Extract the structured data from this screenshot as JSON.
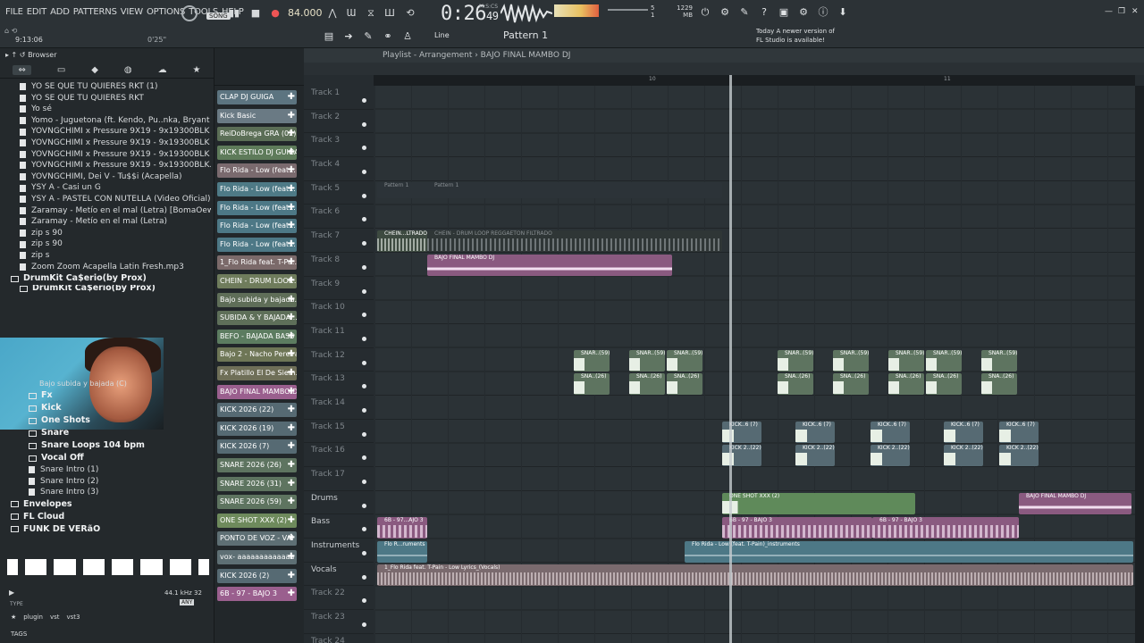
{
  "menu": [
    "FILE",
    "EDIT",
    "ADD",
    "PATTERNS",
    "VIEW",
    "OPTIONS",
    "TOOLS",
    "HELP"
  ],
  "transport": {
    "song_label": "SONG",
    "tempo": "84.000",
    "time": "0:26",
    "time_frac": "49",
    "msc": "M:S:CS",
    "memory": "1229 MB",
    "cpu_top": "5",
    "cpu_bottom": "1"
  },
  "hint": {
    "icon_text": "⌂ ⟲",
    "time": "9:13:06",
    "zoom": "0'25\""
  },
  "toolbar2": {
    "line_label": "Line",
    "pattern_label": "Pattern 1"
  },
  "news": {
    "line1": "Today  A newer version of",
    "line2": "FL Studio is available!"
  },
  "browser": {
    "title": "Browser",
    "files": [
      "YO SE QUE TU QUIERES RKT (1)",
      "YO SE QUE TU QUIERES RKT",
      "Yo sé",
      "Yomo - Juguetona (ft. Kendo, Pu..nka, Bryant Myers, Young Izak)",
      "YOVNGCHIMI x Pressure 9X19 - 9x19300BLK [bass]",
      "YOVNGCHIMI x Pressure 9X19 - 9x19300BLK [vocals]",
      "YOVNGCHIMI x Pressure 9X19 - 9x19300BLK",
      "YOVNGCHIMI x Pressure 9X19 - 9x19300BLK.stem",
      "YOVNGCHIMI, Dei V - Tu$$i (Acapella)",
      "YSY A - Casi un G",
      "YSY A - PASTEL CON NUTELLA (Video Oficial)",
      "Zaramay - Metío en el mal (Letra) [BomaOewl4T0]",
      "Zaramay - Metío en el mal (Letra)",
      "zip s 90",
      "zip s 90",
      "zip s",
      "Zoom Zoom Acapella Latin Fresh.mp3"
    ],
    "folders1": [
      "DrumKit Ca$erio(by Prox)",
      "DrumKit Ca$erio(by Prox)"
    ],
    "file_after_cam": "Bajo subida y bajada (C)",
    "subfolders": [
      "Fx",
      "Kick",
      "One Shots",
      "Snare",
      "Snare Loops 104 bpm",
      "Vocal Off"
    ],
    "snare_intros": [
      "Snare Intro (1)",
      "Snare Intro (2)",
      "Snare Intro (3)"
    ],
    "bottom_folders": [
      "Envelopes",
      "FL Cloud",
      "FUNK DE VERãO"
    ],
    "sample_rate": "44.1 kHz 32",
    "any": "ANY",
    "type_label": "TYPE",
    "filter_tags": [
      "plugin",
      "vst",
      "vst3"
    ],
    "tags_label": "TAGS"
  },
  "channels": [
    {
      "name": "CLAP DJ GUIGA",
      "color": "#5c7480"
    },
    {
      "name": "Kick Basic",
      "color": "#6a7a84"
    },
    {
      "name": "ReiDoBrega GRA (02)",
      "color": "#5b6e56"
    },
    {
      "name": "KICK ESTILO DJ GUIGA",
      "color": "#5e7b5a"
    },
    {
      "name": "Flo Rida - Low (feat...",
      "color": "#7a6a6e"
    },
    {
      "name": "Flo Rida - Low (feat...",
      "color": "#4e7a86"
    },
    {
      "name": "Flo Rida - Low (feat...",
      "color": "#4d7886"
    },
    {
      "name": "Flo Rida - Low (feat...",
      "color": "#4d7886"
    },
    {
      "name": "Flo Rida - Low (feat...",
      "color": "#4d7886"
    },
    {
      "name": "1_Flo Rida feat. T-Pa...",
      "color": "#7b6a6a"
    },
    {
      "name": "CHEIN - DRUM LOOP...",
      "color": "#6f7c5c"
    },
    {
      "name": "Bajo subida y bajada...",
      "color": "#5f6e58"
    },
    {
      "name": "SUBIDA & Y BAJADA...",
      "color": "#5e6f59"
    },
    {
      "name": "BEFO - BAJADA BASS",
      "color": "#5c7c60"
    },
    {
      "name": "Bajo 2 - Nacho Pereira",
      "color": "#6e7656"
    },
    {
      "name": "Fx Platillo El De Siem...",
      "color": "#6f6f58"
    },
    {
      "name": "BAJO FINAL MAMBO DJ",
      "color": "#9a5f8e"
    },
    {
      "name": "KICK 2026 (22)",
      "color": "#566a73"
    },
    {
      "name": "KICK 2026 (19)",
      "color": "#566a73"
    },
    {
      "name": "KICK 2026 (7)",
      "color": "#566a73"
    },
    {
      "name": "SNARE 2026 (26)",
      "color": "#5e7460"
    },
    {
      "name": "SNARE 2026 (31)",
      "color": "#5e7460"
    },
    {
      "name": "SNARE 2026 (59)",
      "color": "#5e7460"
    },
    {
      "name": "ONE SHOT XXX (2)",
      "color": "#6e8a5c"
    },
    {
      "name": "PONTO DE VOZ - VAI",
      "color": "#5e6f74"
    },
    {
      "name": "vox- aaaaaaaaaaaaa",
      "color": "#5e6f74"
    },
    {
      "name": "KICK 2026 (2)",
      "color": "#566a73"
    },
    {
      "name": "6B - 97 - BAJO 3",
      "color": "#9a5f8e"
    }
  ],
  "playlist": {
    "title": "Playlist - Arrangement › BAJO FINAL MAMBO DJ",
    "ruler_marks": [
      "10",
      "11"
    ],
    "tracks": [
      "Track 1",
      "Track 2",
      "Track 3",
      "Track 4",
      "Track 5",
      "Track 6",
      "Track 7",
      "Track 8",
      "Track 9",
      "Track 10",
      "Track 11",
      "Track 12",
      "Track 13",
      "Track 14",
      "Track 15",
      "Track 16",
      "Track 17",
      "Drums",
      "Bass",
      "Instruments",
      "Vocals",
      "Track 22",
      "Track 23",
      "Track 24"
    ],
    "clips": {
      "t4a": "Pattern 1",
      "t4b": "Pattern 1",
      "t7a": "CHEIN...LTRADO",
      "t7b": "CHEIN - DRUM LOOP REGGAETON FILTRADO",
      "t8": "BAJO FINAL MAMBO DJ",
      "sn59": "SNAR..(59)",
      "sn26": "SNA..(26)",
      "k7": "KICK..6 (7)",
      "k22": "KICK 2..(22)",
      "drums1": "ONE SHOT XXX (2)",
      "drums2": "BAJO FINAL MAMBO DJ",
      "bass1": "6B - 97...AJO 3",
      "bass2": "6B - 97 - BAJO 3",
      "bass3": "6B - 97 - BAJO 3",
      "inst1": "Flo R...ruments",
      "inst2": "Flo Rida - Low (feat. T-Pain)_instruments",
      "vocals": "1_Flo Rida feat. T-Pain - Low  Lyrics_(Vocals)"
    }
  }
}
